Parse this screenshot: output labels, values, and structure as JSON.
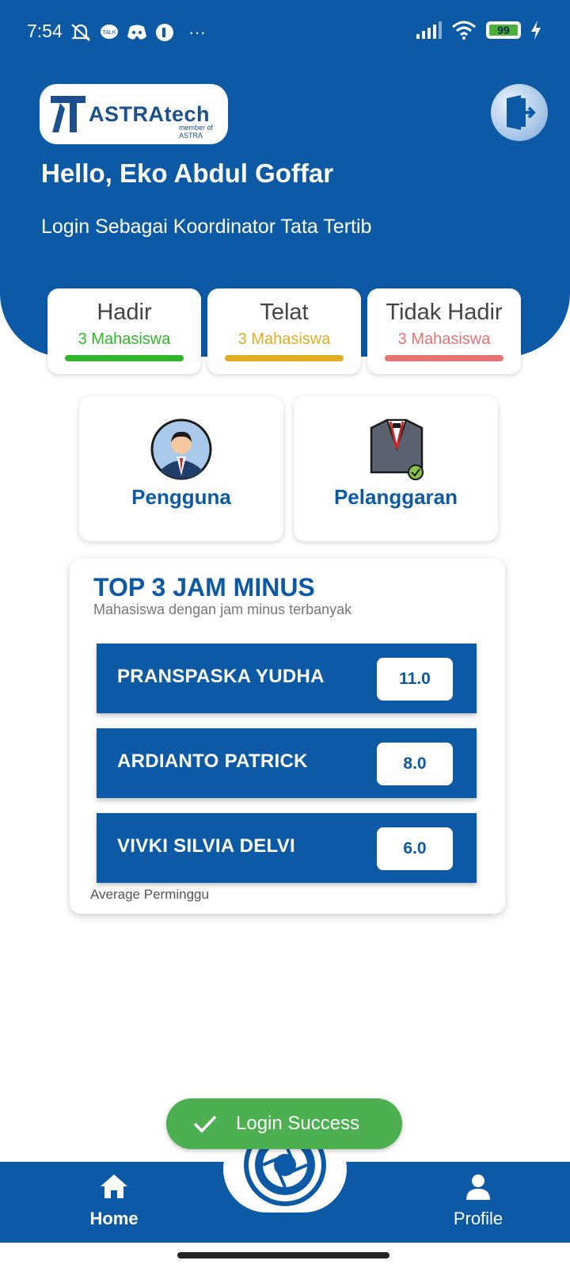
{
  "status_bar": {
    "time": "7:54",
    "left_icons": [
      "mute-icon",
      "talk-icon",
      "discord-icon",
      "app-icon"
    ],
    "more": "···",
    "battery": "99",
    "right_icons": [
      "signal-icon",
      "wifi-icon",
      "battery-icon",
      "charging-icon"
    ]
  },
  "header": {
    "logo_text": "ASTRAtech",
    "logo_sub": "member of ASTRA",
    "greeting": "Hello, Eko Abdul Goffar",
    "role": "Login Sebagai Koordinator Tata Tertib"
  },
  "stats": [
    {
      "title": "Hadir",
      "value": "3 Mahasiswa",
      "color": "#2fb52a"
    },
    {
      "title": "Telat",
      "value": "3 Mahasiswa",
      "color": "#e0ad22"
    },
    {
      "title": "Tidak Hadir",
      "value": "3 Mahasiswa",
      "color": "#e57373"
    }
  ],
  "menu": [
    {
      "label": "Pengguna",
      "icon": "user-avatar-icon"
    },
    {
      "label": "Pelanggaran",
      "icon": "uniform-icon"
    }
  ],
  "top3": {
    "title": "TOP 3 JAM MINUS",
    "subtitle": "Mahasiswa dengan jam minus terbanyak",
    "rows": [
      {
        "name": "PRANSPASKA YUDHA",
        "value": "11.0"
      },
      {
        "name": "ARDIANTO PATRICK",
        "value": "8.0"
      },
      {
        "name": "VIVKI SILVIA DELVI",
        "value": "6.0"
      }
    ],
    "footer": "Average Perminggu"
  },
  "toast": {
    "text": "Login Success"
  },
  "nav": {
    "home": "Home",
    "profile": "Profile"
  },
  "colors": {
    "primary": "#0c5aa6",
    "success": "#4caf50"
  }
}
